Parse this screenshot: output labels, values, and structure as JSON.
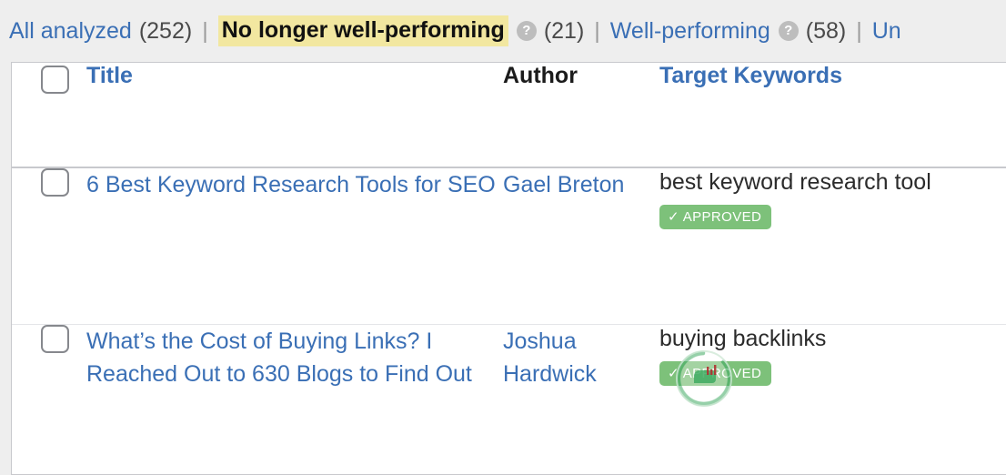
{
  "filters": {
    "items": [
      {
        "label": "All analyzed",
        "count": "(252)",
        "active": false,
        "help": false
      },
      {
        "label": "No longer well-performing",
        "count": "(21)",
        "active": true,
        "help": true,
        "help_icon": "question-mark-circle-icon"
      },
      {
        "label": "Well-performing",
        "count": "(58)",
        "active": false,
        "help": true,
        "help_icon": "question-mark-circle-icon"
      },
      {
        "label": "Un",
        "count": "",
        "active": false,
        "help": false
      }
    ],
    "separator": "|"
  },
  "table": {
    "headers": {
      "select_all": "select-all-checkbox",
      "title": "Title",
      "author": "Author",
      "keywords": "Target Keywords"
    },
    "rows": [
      {
        "title": "6 Best Keyword Research Tools for SEO",
        "author": "Gael Breton",
        "keyword": "best keyword research tool",
        "badge": "✓ APPROVED",
        "loading": false
      },
      {
        "title": "What’s the Cost of Buying Links? I Reached Out to 630 Blogs to Find Out",
        "author": "Joshua Hardwick",
        "keyword": "buying backlinks",
        "badge": "✓ APPROVED",
        "loading": true
      }
    ]
  },
  "colors": {
    "link_blue": "#3a6fb5",
    "highlight_yellow": "#f2e7a0",
    "badge_green": "#7dc17a",
    "page_background": "#eeeeee",
    "help_icon_gray": "#bdbdbd"
  }
}
